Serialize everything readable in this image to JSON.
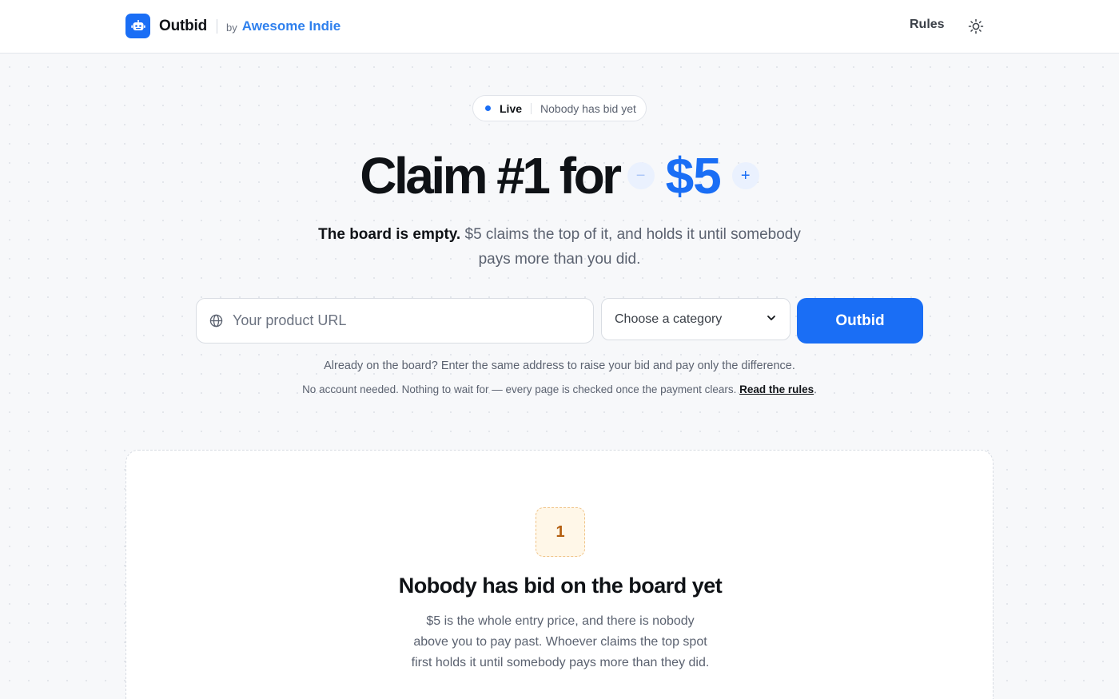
{
  "header": {
    "brand_name": "Outbid",
    "by_label": "by",
    "author": "Awesome Indie",
    "nav_rules": "Rules",
    "logo_icon": "robot-icon",
    "theme_icon": "sun-icon"
  },
  "status_pill": {
    "live_label": "Live",
    "status_text": "Nobody has bid yet"
  },
  "hero": {
    "headline": "Claim #1 for",
    "price": "$5",
    "minus_label": "−",
    "plus_label": "+",
    "subtitle_strong": "The board is empty.",
    "subtitle_rest": " $5 claims the top of it, and holds it until somebody pays more than you did."
  },
  "form": {
    "url_placeholder": "Your product URL",
    "url_value": "",
    "category_selected": "Choose a category",
    "submit_label": "Outbid",
    "globe_icon": "globe-icon",
    "chevron_icon": "chevron-down-icon"
  },
  "notes": {
    "line1": "Already on the board? Enter the same address to raise your bid and pay only the difference.",
    "line2_text": "No account needed. Nothing to wait for — every page is checked once the payment clears. ",
    "line2_link": "Read the rules",
    "line2_end": "."
  },
  "board": {
    "rank": "1",
    "empty_title": "Nobody has bid on the board yet",
    "empty_body": "$5 is the whole entry price, and there is nobody above you to pay past. Whoever claims the top spot first holds it until somebody pays more than they did."
  },
  "colors": {
    "accent": "#1a6ef5",
    "author": "#2f80ed",
    "rank_badge_bg": "#fff7e8",
    "rank_badge_text": "#b45f10"
  }
}
